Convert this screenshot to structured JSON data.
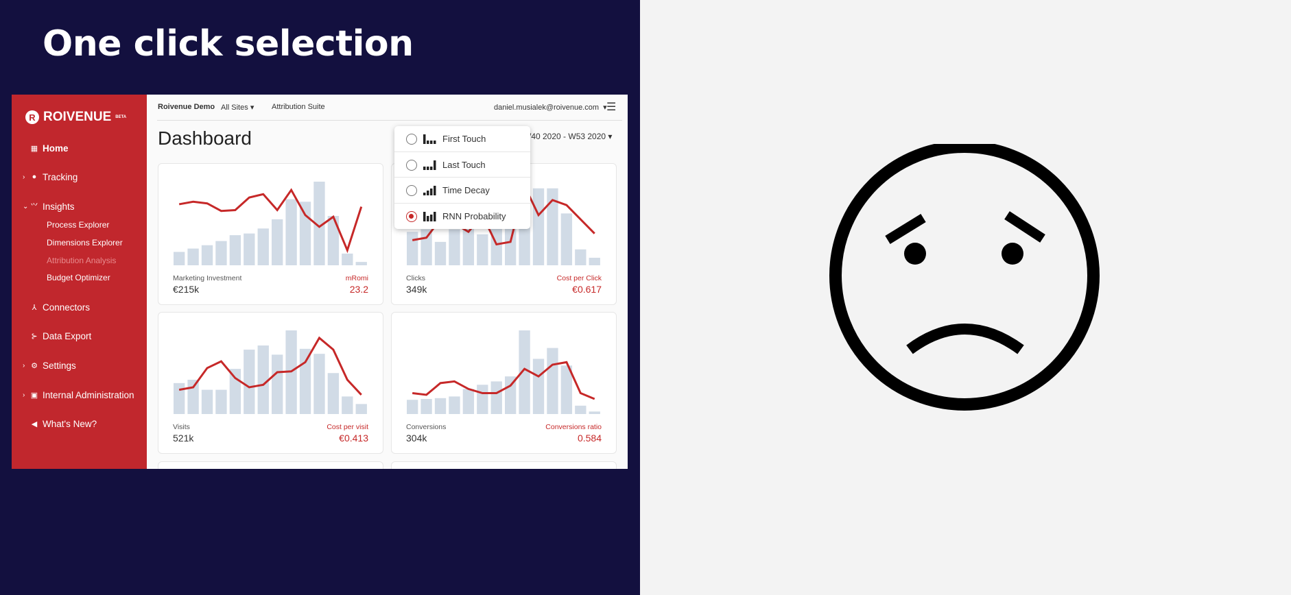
{
  "slide_title": "One click selection",
  "sidebar": {
    "brand": "ROIVENUE",
    "brand_badge": "BETA",
    "items": [
      {
        "label": "Home",
        "icon": "grid-icon"
      },
      {
        "label": "Tracking",
        "icon": "compass-icon"
      },
      {
        "label": "Insights",
        "icon": "trend-icon"
      },
      {
        "label": "Connectors",
        "icon": "network-icon"
      },
      {
        "label": "Data Export",
        "icon": "export-icon"
      },
      {
        "label": "Settings",
        "icon": "gear-icon"
      },
      {
        "label": "Internal Administration",
        "icon": "admin-icon"
      },
      {
        "label": "What's New?",
        "icon": "megaphone-icon"
      }
    ],
    "insights_sub": [
      "Process Explorer",
      "Dimensions Explorer",
      "Attribution Analysis",
      "Budget Optimizer"
    ]
  },
  "header": {
    "account": "Roivenue Demo",
    "site": "All Sites",
    "suite": "Attribution Suite",
    "user": "daniel.musialek@roivenue.com"
  },
  "page_title": "Dashboard",
  "date_range": "W40 2020 - W53 2020",
  "attribution_menu": {
    "options": [
      "First Touch",
      "Last Touch",
      "Time Decay",
      "RNN Probability"
    ],
    "selected": "RNN Probability"
  },
  "colors": {
    "accent": "#c1272d",
    "line": "#c62828",
    "bar": "#d1dbe6",
    "background": "#13103f"
  },
  "chart_data": [
    {
      "type": "bar+line",
      "left_label": "Marketing Investment",
      "left_value": "€215k",
      "right_label": "mRomi",
      "right_value": "23.2",
      "bars": [
        16,
        20,
        24,
        29,
        36,
        38,
        44,
        55,
        79,
        76,
        100,
        59,
        14,
        4
      ],
      "line": [
        73,
        76,
        74,
        65,
        66,
        81,
        85,
        66,
        90,
        60,
        46,
        58,
        18,
        70
      ]
    },
    {
      "type": "bar+line",
      "left_label": "Clicks",
      "left_value": "349k",
      "right_label": "Cost per Click",
      "right_value": "€0.617",
      "bars": [
        40,
        43,
        28,
        43,
        50,
        37,
        45,
        50,
        62,
        92,
        92,
        62,
        19,
        9
      ],
      "line": [
        30,
        33,
        55,
        50,
        40,
        60,
        25,
        28,
        95,
        60,
        78,
        72,
        55,
        38
      ]
    },
    {
      "type": "bar+line",
      "left_label": "Visits",
      "left_value": "521k",
      "right_label": "Cost per visit",
      "right_value": "€0.413",
      "bars": [
        37,
        41,
        29,
        29,
        54,
        77,
        82,
        71,
        100,
        78,
        72,
        49,
        21,
        12
      ],
      "line": [
        29,
        32,
        55,
        63,
        43,
        32,
        35,
        50,
        51,
        62,
        91,
        77,
        41,
        23
      ]
    },
    {
      "type": "bar+line",
      "left_label": "Conversions",
      "left_value": "304k",
      "right_label": "Conversions ratio",
      "right_value": "0.584",
      "bars": [
        17,
        18,
        19,
        21,
        30,
        35,
        39,
        45,
        100,
        66,
        79,
        58,
        10,
        3
      ],
      "line": [
        25,
        23,
        37,
        39,
        30,
        25,
        25,
        34,
        54,
        45,
        59,
        62,
        25,
        18
      ]
    }
  ]
}
